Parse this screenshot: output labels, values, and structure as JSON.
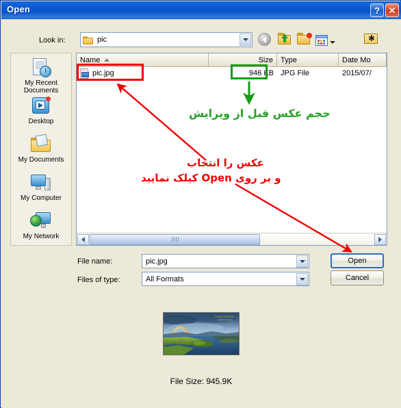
{
  "window": {
    "title": "Open",
    "help_button": "?",
    "close_button": "✕"
  },
  "lookin": {
    "label": "Look in:",
    "value": "pic",
    "icon": "folder-icon",
    "dropdown_icon": "chevron-down-icon"
  },
  "toolbar": {
    "back": "back-icon",
    "up_one_level": "up-one-level-icon",
    "create_new_folder": "new-folder-icon",
    "views": "views-icon",
    "views_caret": "chevron-down-icon",
    "tools": "tools-folder-icon"
  },
  "places": {
    "items": [
      {
        "label": "My Recent\nDocuments",
        "label_line1": "My Recent",
        "label_line2": "Documents",
        "icon": "recent-documents-icon"
      },
      {
        "label": "Desktop",
        "icon": "desktop-icon"
      },
      {
        "label": "My Documents",
        "icon": "my-documents-icon"
      },
      {
        "label": "My Computer",
        "icon": "my-computer-icon"
      },
      {
        "label": "My Network",
        "icon": "my-network-icon"
      }
    ]
  },
  "filelist": {
    "columns": [
      "Name",
      "Size",
      "Type",
      "Date Mo"
    ],
    "sort_column": "Name",
    "sort_direction": "ascending",
    "rows": [
      {
        "name": "pic.jpg",
        "size": "946 KB",
        "type": "JPG File",
        "date_modified": "2015/07/",
        "icon": "jpg-file-icon"
      }
    ],
    "hscroll": {
      "left_arrow": "chevron-left-icon",
      "right_arrow": "chevron-right-icon"
    }
  },
  "form": {
    "filename_label": "File name:",
    "filename_value": "pic.jpg",
    "filetype_label": "Files of type:",
    "filetype_value": "All Formats",
    "open_button": "Open",
    "cancel_button": "Cancel"
  },
  "preview": {
    "filesize_text": "File Size: 945.9K",
    "image_description": "landscape-photo-rainbow-lake"
  },
  "annotations": {
    "green_text": "حجم عکس قبل از ویرایش",
    "red_text_line1": "عکس را انتخاب",
    "red_text_line2": "و بر روی Open کیلک نمایید",
    "red_color": "#f50000",
    "green_color": "#26a226",
    "red_box_target": "pic.jpg",
    "green_box_target": "946 KB"
  },
  "colors": {
    "titlebar_blue": "#0a57cf",
    "dialog_face": "#ece9d8",
    "accent_border": "#7f9db9",
    "annotation_red": "#ee0000",
    "annotation_green": "#169c16"
  }
}
